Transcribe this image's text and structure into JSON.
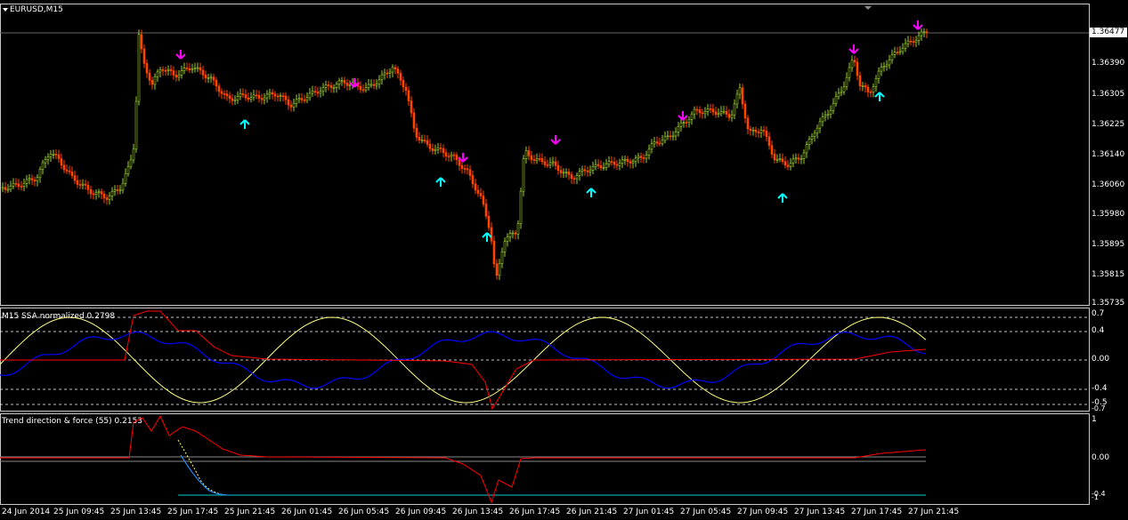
{
  "main": {
    "symbol": "EURUSD,M15",
    "current_price": "1.36477",
    "y_labels": [
      "1.36390",
      "1.36305",
      "1.36225",
      "1.36140",
      "1.36060",
      "1.35980",
      "1.35895",
      "1.35815",
      "1.35735"
    ]
  },
  "osc": {
    "title": "M15 SSA normalized 0.2798",
    "y_labels": [
      "0.7",
      "0.4",
      "0.00",
      "-0.4",
      "-0.5",
      "-0.7"
    ]
  },
  "trend": {
    "title": "Trend direction & force (55) 0.2153",
    "y_labels": [
      "1",
      "0.00",
      "-0.4",
      "-1"
    ]
  },
  "x_labels": [
    "24 Jun 2014",
    "25 Jun 09:45",
    "25 Jun 13:45",
    "25 Jun 17:45",
    "25 Jun 21:45",
    "26 Jun 01:45",
    "26 Jun 05:45",
    "26 Jun 09:45",
    "26 Jun 13:45",
    "26 Jun 17:45",
    "26 Jun 21:45",
    "27 Jun 01:45",
    "27 Jun 05:45",
    "27 Jun 09:45",
    "27 Jun 13:45",
    "27 Jun 17:45",
    "27 Jun 21:45"
  ],
  "colors": {
    "bull": "#9acd32",
    "bear": "#ff4500",
    "buy_arrow": "#00ffff",
    "sell_arrow": "#ff00ff",
    "osc_yellow": "#ffff80",
    "osc_blue": "#0000ff",
    "osc_red": "#ff0000"
  }
}
